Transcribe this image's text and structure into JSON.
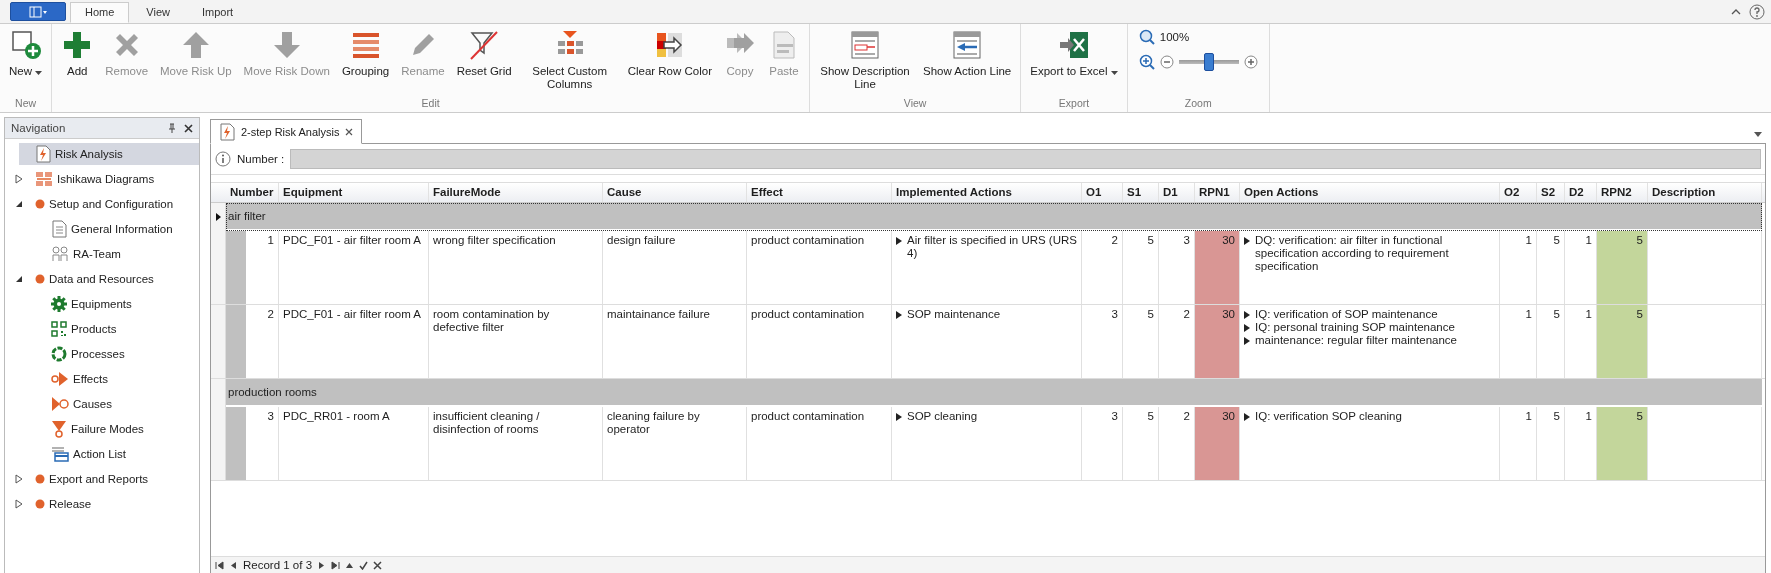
{
  "app_tabs": [
    {
      "label": "Home",
      "selected": true
    },
    {
      "label": "View",
      "selected": false
    },
    {
      "label": "Import",
      "selected": false
    }
  ],
  "ribbon": {
    "groups": [
      {
        "label": "New",
        "buttons": [
          {
            "label": "New",
            "disabled": false,
            "dropdown": true
          }
        ]
      },
      {
        "label": "Edit",
        "buttons": [
          {
            "label": "Add",
            "disabled": false,
            "dropdown": false
          },
          {
            "label": "Remove",
            "disabled": true,
            "dropdown": false
          },
          {
            "label": "Move Risk Up",
            "disabled": true,
            "dropdown": false
          },
          {
            "label": "Move Risk Down",
            "disabled": true,
            "dropdown": false
          },
          {
            "label": "Grouping",
            "disabled": false,
            "dropdown": false
          },
          {
            "label": "Rename",
            "disabled": true,
            "dropdown": false
          },
          {
            "label": "Reset Grid",
            "disabled": false,
            "dropdown": false
          },
          {
            "label": "Select Custom Columns",
            "disabled": false,
            "dropdown": false
          },
          {
            "label": "Clear Row Color",
            "disabled": false,
            "dropdown": false
          },
          {
            "label": "Copy",
            "disabled": true,
            "dropdown": false
          },
          {
            "label": "Paste",
            "disabled": true,
            "dropdown": false
          }
        ]
      },
      {
        "label": "View",
        "buttons": [
          {
            "label": "Show Description Line",
            "disabled": false,
            "dropdown": false
          },
          {
            "label": "Show Action Line",
            "disabled": false,
            "dropdown": false
          }
        ]
      },
      {
        "label": "Export",
        "buttons": [
          {
            "label": "Export to Excel",
            "disabled": false,
            "dropdown": true
          }
        ]
      }
    ],
    "zoom": {
      "label": "Zoom",
      "value": "100%",
      "level": 0.5
    }
  },
  "navigation": {
    "title": "Navigation",
    "items": [
      {
        "label": "Risk Analysis",
        "selected": true
      },
      {
        "label": "Ishikawa Diagrams",
        "selected": false,
        "expanded": false
      },
      {
        "label": "Setup and Configuration",
        "selected": false,
        "expanded": true,
        "children": [
          {
            "label": "General Information",
            "selected": false
          },
          {
            "label": "RA-Team",
            "selected": false
          }
        ]
      },
      {
        "label": "Data and Resources",
        "selected": false,
        "expanded": true,
        "children": [
          {
            "label": "Equipments",
            "selected": false
          },
          {
            "label": "Products",
            "selected": false
          },
          {
            "label": "Processes",
            "selected": false
          },
          {
            "label": "Effects",
            "selected": false
          },
          {
            "label": "Causes",
            "selected": false
          },
          {
            "label": "Failure Modes",
            "selected": false
          },
          {
            "label": "Action List",
            "selected": false
          }
        ]
      },
      {
        "label": "Export and Reports",
        "selected": false,
        "expanded": false
      },
      {
        "label": "Release",
        "selected": false,
        "expanded": false
      }
    ]
  },
  "document": {
    "tab": "2-step Risk Analysis",
    "filter": {
      "label": "Number :"
    },
    "table": {
      "columns": [
        "Number",
        "Equipment",
        "FailureMode",
        "Cause",
        "Effect",
        "Implemented Actions",
        "O1",
        "S1",
        "D1",
        "RPN1",
        "Open Actions",
        "O2",
        "S2",
        "D2",
        "RPN2",
        "Description"
      ],
      "groups": [
        {
          "label": "air filter",
          "focused": true,
          "rows": [
            {
              "number": "1",
              "equipment": "PDC_F01 - air filter room A",
              "failure_mode": "wrong filter specification",
              "cause": "design failure",
              "effect": "product contamination",
              "implemented_actions": [
                "Air filter is specified in URS (URS 4)"
              ],
              "o1": "2",
              "s1": "5",
              "d1": "3",
              "rpn1": {
                "value": "30",
                "color": "#d99694"
              },
              "open_actions": [
                "DQ: verification: air filter in functional specification according to requirement specification"
              ],
              "o2": "1",
              "s2": "5",
              "d2": "1",
              "rpn2": {
                "value": "5",
                "color": "#c3d69b"
              }
            },
            {
              "number": "2",
              "equipment": "PDC_F01 - air filter room A",
              "failure_mode": "room contamination by defective filter",
              "cause": "maintainance failure",
              "effect": "product contamination",
              "implemented_actions": [
                "SOP maintenance"
              ],
              "o1": "3",
              "s1": "5",
              "d1": "2",
              "rpn1": {
                "value": "30",
                "color": "#d99694"
              },
              "open_actions": [
                "IQ: verification of SOP maintenance",
                "IQ: personal  training SOP maintenance",
                "maintenance: regular filter maintenance"
              ],
              "o2": "1",
              "s2": "5",
              "d2": "1",
              "rpn2": {
                "value": "5",
                "color": "#c3d69b"
              }
            }
          ]
        },
        {
          "label": "production rooms",
          "focused": false,
          "rows": [
            {
              "number": "3",
              "equipment": "PDC_RR01 - room A",
              "failure_mode": "insufficient cleaning / disinfection of rooms",
              "cause": "cleaning failure by operator",
              "effect": "product contamination",
              "implemented_actions": [
                "SOP cleaning"
              ],
              "o1": "3",
              "s1": "5",
              "d1": "2",
              "rpn1": {
                "value": "30",
                "color": "#d99694"
              },
              "open_actions": [
                "IQ: verification SOP cleaning"
              ],
              "o2": "1",
              "s2": "5",
              "d2": "1",
              "rpn2": {
                "value": "5",
                "color": "#c3d69b"
              }
            }
          ]
        }
      ]
    },
    "record": "Record 1 of 3"
  }
}
